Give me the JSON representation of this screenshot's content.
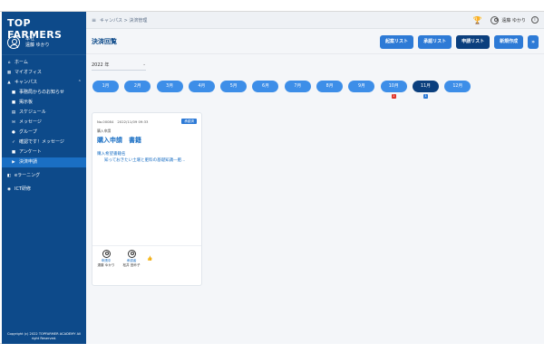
{
  "sidebar": {
    "brand": "TOP FARMERS",
    "user_line1": "本社",
    "user_line2": "遠藤 ゆかり",
    "items": [
      {
        "icon": "home-icon",
        "label": "ホーム"
      },
      {
        "icon": "office-icon",
        "label": "マイオフィス"
      },
      {
        "icon": "campus-icon",
        "label": "キャンパス"
      },
      {
        "icon": "notice-icon",
        "label": "事務局からのお知らせ"
      },
      {
        "icon": "board-icon",
        "label": "掲示板"
      },
      {
        "icon": "calendar-icon",
        "label": "スケジュール"
      },
      {
        "icon": "message-icon",
        "label": "メッセージ"
      },
      {
        "icon": "group-icon",
        "label": "グループ"
      },
      {
        "icon": "confirm-icon",
        "label": "確認です！メッセージ"
      },
      {
        "icon": "survey-icon",
        "label": "アンケート"
      },
      {
        "icon": "approval-icon",
        "label": "決済申請"
      },
      {
        "icon": "elearning-icon",
        "label": "eラーニング"
      },
      {
        "icon": "ict-icon",
        "label": "ICT研修"
      }
    ],
    "copyright": "Copyright (c) 2022 TOPFARMER ACADEMY All right Reserved."
  },
  "topbar": {
    "breadcrumb": "キャンパス > 決済管理",
    "user_name": "遠藤 ゆかり"
  },
  "header": {
    "title": "決済回覧",
    "buttons": [
      "起案リスト",
      "承認リスト",
      "申請リスト",
      "新規作成"
    ],
    "more_label": "»"
  },
  "filter": {
    "year": "2022 年"
  },
  "months": [
    {
      "label": "1月",
      "badge": ""
    },
    {
      "label": "2月",
      "badge": ""
    },
    {
      "label": "3月",
      "badge": ""
    },
    {
      "label": "4月",
      "badge": ""
    },
    {
      "label": "5月",
      "badge": ""
    },
    {
      "label": "6月",
      "badge": ""
    },
    {
      "label": "7月",
      "badge": ""
    },
    {
      "label": "8月",
      "badge": ""
    },
    {
      "label": "9月",
      "badge": ""
    },
    {
      "label": "10月",
      "badge": "1"
    },
    {
      "label": "11月",
      "badge": "1"
    },
    {
      "label": "12月",
      "badge": ""
    }
  ],
  "card": {
    "number": "No.00084",
    "datetime": "2022/11/09 09:33",
    "status": "承認済",
    "kind_label": "購入申請",
    "kind": "購入申請　書籍",
    "book_label": "購入希望書籍名",
    "book_title": "知っておきたい土壌と肥料の基礎知識―肥...",
    "approvers": [
      {
        "status": "申請中",
        "name": "遠藤 ゆかり"
      },
      {
        "status": "承認者",
        "name": "松井 田紗子"
      }
    ],
    "thumb_icon": "thumbs-up-icon"
  },
  "colors": {
    "sidebar": "#0d4a8a",
    "accent": "#2d7ad6",
    "selected": "#0b3f7e",
    "badge_red": "#e0352b"
  }
}
